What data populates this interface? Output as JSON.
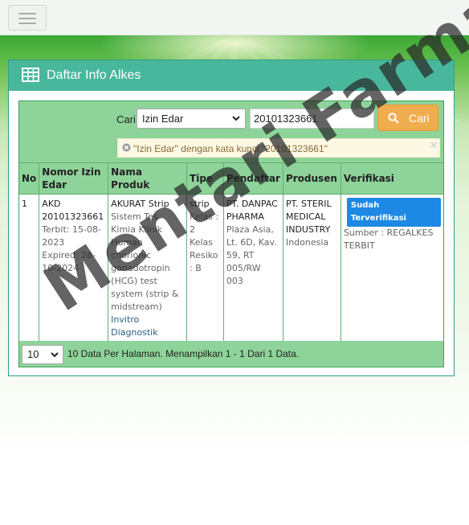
{
  "panel": {
    "title": "Daftar Info Alkes"
  },
  "search": {
    "label": "Cari",
    "field_selected": "Izin Edar",
    "keyword": "20101323661",
    "button_label": "Cari",
    "filter_text": "\"Izin Edar\" dengan kata kunci \"20101323661\"",
    "filter_close": "×"
  },
  "table": {
    "headers": [
      "No",
      "Nomor Izin Edar",
      "Nama Produk",
      "Tipe",
      "Pendaftar",
      "Produsen",
      "Verifikasi"
    ],
    "rows": [
      {
        "no": "1",
        "nomor_izin": "AKD 20101323661",
        "terbit": "Terbit: 15-08-2023",
        "expired": "Expired: 28-10-2024",
        "produk_nama": "AKURAT Strip",
        "produk_desc": "Sistem Tes Kimia Klinik Human chorionic gonadotropin (HCG) test system (strip & midstream)",
        "produk_link": "Invitro Diagnostik",
        "tipe": "strip",
        "kelas": "Kelas : 2",
        "kelas_resiko": "Kelas Resiko : B",
        "pendaftar_nama": "PT. DANPAC PHARMA",
        "pendaftar_alamat": "Plaza Asia, Lt. 6D, Kav. 59, RT 005/RW 003",
        "produsen_nama": "PT. STERIL MEDICAL INDUSTRY",
        "produsen_negara": "Indonesia",
        "verifikasi_status": "Sudah Terverifikasi",
        "verifikasi_sumber": "Sumber : REGALKES TERBIT"
      }
    ]
  },
  "footer": {
    "per_page": "10",
    "summary": "10 Data Per Halaman. Menampilkan 1 - 1 Dari 1 Data."
  },
  "watermark": "Mentari Farma",
  "colors": {
    "panel_header": "#48b79b",
    "table_header": "#8ed39a",
    "button": "#f0ad4e",
    "verified_badge": "#1e88e5"
  },
  "icons": [
    "hamburger-icon",
    "table-icon",
    "search-icon",
    "remove-filter-icon",
    "close-icon",
    "chevron-down-icon"
  ]
}
